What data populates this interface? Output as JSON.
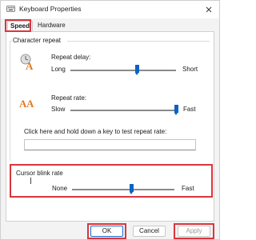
{
  "window": {
    "title": "Keyboard Properties",
    "icon": "keyboard-icon",
    "close_icon": "close-icon"
  },
  "tabs": [
    {
      "label": "Speed",
      "selected": true
    },
    {
      "label": "Hardware",
      "selected": false
    }
  ],
  "character_repeat": {
    "title": "Character repeat",
    "repeat_delay": {
      "label": "Repeat delay:",
      "min_label": "Long",
      "max_label": "Short",
      "value_percent": 63
    },
    "repeat_rate": {
      "label": "Repeat rate:",
      "min_label": "Slow",
      "max_label": "Fast",
      "value_percent": 100
    },
    "test_prompt": "Click here and hold down a key to test repeat rate:",
    "test_value": ""
  },
  "cursor_blink": {
    "title": "Cursor blink rate",
    "min_label": "None",
    "max_label": "Fast",
    "value_percent": 58
  },
  "buttons": {
    "ok": "OK",
    "cancel": "Cancel",
    "apply": "Apply"
  },
  "colors": {
    "accent": "#0a62c7",
    "highlight": "#d9363e"
  }
}
